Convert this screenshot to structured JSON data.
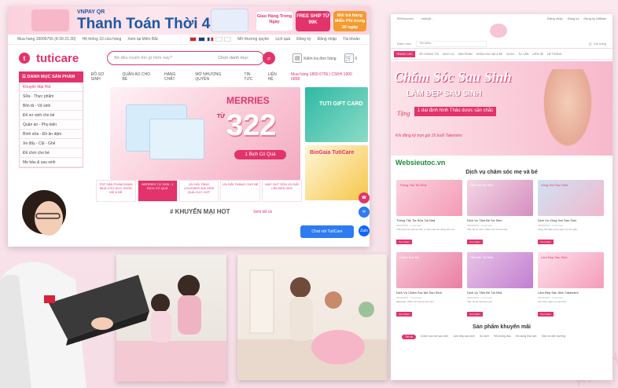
{
  "left_site": {
    "banner": {
      "vnpay": "VNPAY QR",
      "headline": "Thanh Toán Thời 4.0",
      "delivery": "Giao Hàng Trong Ngày",
      "freeship": "FREE SHIP TỪ 99K",
      "free": "Đổi trả hàng Miễn Phí trong 30 ngày"
    },
    "topbar": {
      "hotline": "Mua hàng 18006755 (8:30-21:30)",
      "stores": "Hệ thống 10 cửa hàng",
      "region": "Xem tại Miền Bắc",
      "links": [
        "Mở thương quyền",
        "Lịch quà",
        "Đăng ký",
        "Đăng nhập",
        "Tài khoản"
      ]
    },
    "logo": "tuticare",
    "search": {
      "placeholder": "Bé đều muốn tìm gì hôm nay?",
      "category": "Chọn danh mục"
    },
    "header_links": [
      "Kiểm tra đơn hàng",
      "0"
    ],
    "nav": {
      "category_button": "DANH MỤC SẢN PHẨM",
      "items": [
        "ĐỒ SƠ SINH",
        "QUẦN ÁO CHO BÉ",
        "HÀNG CHẤT",
        "MỞ NHƯỢNG QUYỀN",
        "TIN TỨC",
        "LIÊN HỆ"
      ],
      "hotline": "Mua hàng 1800 6755 | CSKH 1900 6858"
    },
    "sidebar": [
      "Khuyến Mại Hot",
      "Sữa - Thực phẩm",
      "Bỉm tã - Vệ sinh",
      "Đồ sơ sinh cho bé",
      "Quần áo - Phụ kiện",
      "Bình sữa - Đồ ăn dặm",
      "Xe đẩy - Cũi - Ghế",
      "Đồ chơi cho bé",
      "Mẹ bầu & sau sinh"
    ],
    "main_banner": {
      "brand": "MERRIES",
      "prefix": "TỪ",
      "price": "322",
      "pill": "1 Bịch Có Quà"
    },
    "promos": [
      "TOP SẢN PHẨM ĐÁNG MUA CHO SỨC KHỎE MẸ & BÉ",
      "MERRIES TỪ 322K, 1 BỊCH CÓ QUÀ",
      "ƯU ĐÃI TẶNG VOUCHER 50K KÈM QUÀ CỰC HOT",
      "ƯU ĐÃI THÁNG CHO BÉ",
      "MÁY HÚT SỮA ƯU ĐÃI LÊN ĐẾN 30%"
    ],
    "side_banners": [
      "TUTI GIFT CARD",
      "BioGaia TutiCare"
    ],
    "section": {
      "title": "# KHUYẾN MẠI HOT",
      "more": "Xem tất cả"
    },
    "chat": "Chat với TutiCare",
    "zalo": "Zalo"
  },
  "right_site": {
    "topbar": {
      "phone": "0904xxxxxx",
      "email": "cskh@...",
      "links": [
        "Đăng nhập",
        "Đăng ký",
        "Đăng ký Affiliate"
      ]
    },
    "search_label": "Danh mục",
    "search_placeholder": "Tìm kiếm...",
    "cart": "Giỏ hàng",
    "nav": [
      "TRANG CHỦ",
      "VỀ CHÚNG TÔI",
      "DỊCH VỤ",
      "SẢN PHẨM",
      "KHÓA HỌC MẸ & BÉ",
      "BLOG",
      "TƯ VẤN",
      "LIÊN HỆ",
      "HỆ THỐNG"
    ],
    "hero": {
      "title": "Chăm Sóc Sau Sinh",
      "subtitle": "LÀM ĐẸP SAU SINH",
      "offer_prefix": "Tặng",
      "offer": "1 dai định hình Thảo dược săn chắc",
      "note": "Khi đăng ký trọn gói 15 buổi Takemimi"
    },
    "brand": "Websieutoc.vn",
    "section_title": "Dịch vụ chăm sóc mẹ và bé",
    "cards": [
      {
        "title": "Thông Tắc Tia Sữa Tại Nhà",
        "meta": "29/04/2019 · 1 lượt xem",
        "desc": "Thông tắc tia sữa tại nhà, tư vấn nuôi con bằng sữa mẹ.",
        "more": "Xem thêm"
      },
      {
        "title": "Dịch Vụ Tắm Bé Sơ Sinh",
        "meta": "29/04/2019 · 1 lượt xem",
        "desc": "Tắm bé sơ sinh, chăm sóc rốn an toàn.",
        "more": "Xem thêm"
      },
      {
        "title": "Dịch Vụ Xông Hơi Sau Sinh",
        "meta": "29/04/2019 · 1 lượt xem",
        "desc": "Xông hơi thảo dược giúp mẹ thư giãn.",
        "more": "Xem thêm"
      },
      {
        "title": "Dịch Vụ Chăm Sóc Mẹ Sau Sinh",
        "meta": "29/04/2019 · 1 lượt xem",
        "desc": "Massage, chăm sóc da mẹ sau sinh.",
        "more": "Xem thêm"
      },
      {
        "title": "Dịch Vụ Tắm Bé Tại Nhà",
        "meta": "29/04/2019 · 1 lượt xem",
        "desc": "Tắm bé tại nhà theo giờ.",
        "more": "Xem thêm"
      },
      {
        "title": "Làm Đẹp Sau Sinh Takemimi",
        "meta": "29/04/2019 · 1 lượt xem",
        "desc": "Làm đẹp, giảm eo sau sinh.",
        "more": "Xem thêm"
      }
    ],
    "card_banners": [
      "Thông Tắc Tia Sữa",
      "Tắm Bé Sơ Sinh",
      "Xông Hơi Sau Sinh",
      "Chăm Sóc Mẹ",
      "Tắm Bé Tại Nhà",
      "Làm Đẹp Sau Sinh"
    ],
    "promo_title": "Sản phẩm khuyến mãi",
    "promo_tabs": [
      "Tất cả",
      "Chăm sóc mẹ sau sinh",
      "Làm đẹp sau sinh",
      "Sơ sinh",
      "Hỗ phòng đầu",
      "Đồ dùng thai sản",
      "Sữa và dinh dưỡng"
    ]
  },
  "colors": {
    "accent": "#e2336b",
    "brand_blue": "#1b59a8",
    "brand_green": "#1a8d3a"
  }
}
